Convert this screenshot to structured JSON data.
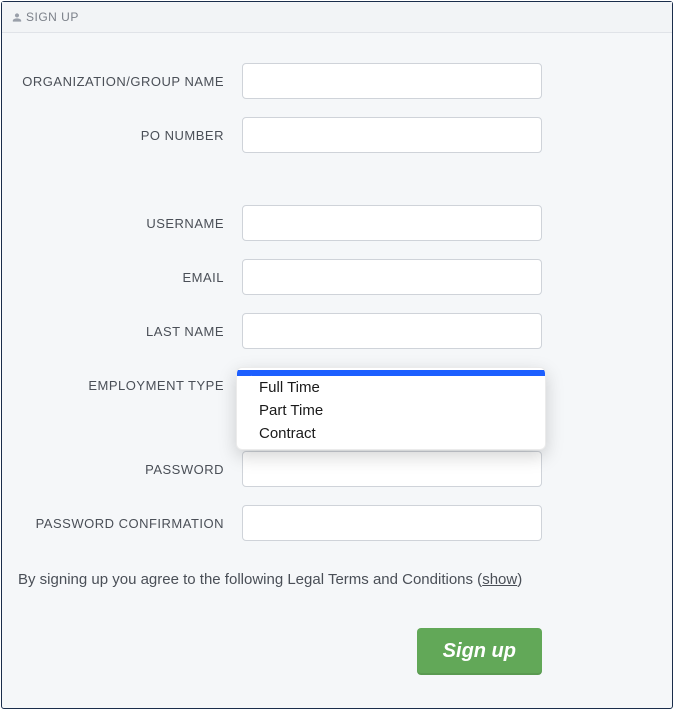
{
  "header": {
    "title": "SIGN UP"
  },
  "fields": {
    "org_name": {
      "label": "ORGANIZATION/GROUP NAME",
      "value": ""
    },
    "po_number": {
      "label": "PO NUMBER",
      "value": ""
    },
    "username": {
      "label": "USERNAME",
      "value": ""
    },
    "email": {
      "label": "EMAIL",
      "value": ""
    },
    "last_name": {
      "label": "LAST NAME",
      "value": ""
    },
    "employment": {
      "label": "EMPLOYMENT TYPE",
      "selected": "",
      "options": [
        "",
        "Full Time",
        "Part Time",
        "Contract"
      ]
    },
    "password": {
      "label": "PASSWORD",
      "value": ""
    },
    "password_conf": {
      "label": "PASSWORD CONFIRMATION",
      "value": ""
    }
  },
  "terms": {
    "prefix": "By signing up you agree to the following Legal Terms and Conditions (",
    "link_text": "show",
    "suffix": ")"
  },
  "submit": {
    "label": "Sign up"
  }
}
